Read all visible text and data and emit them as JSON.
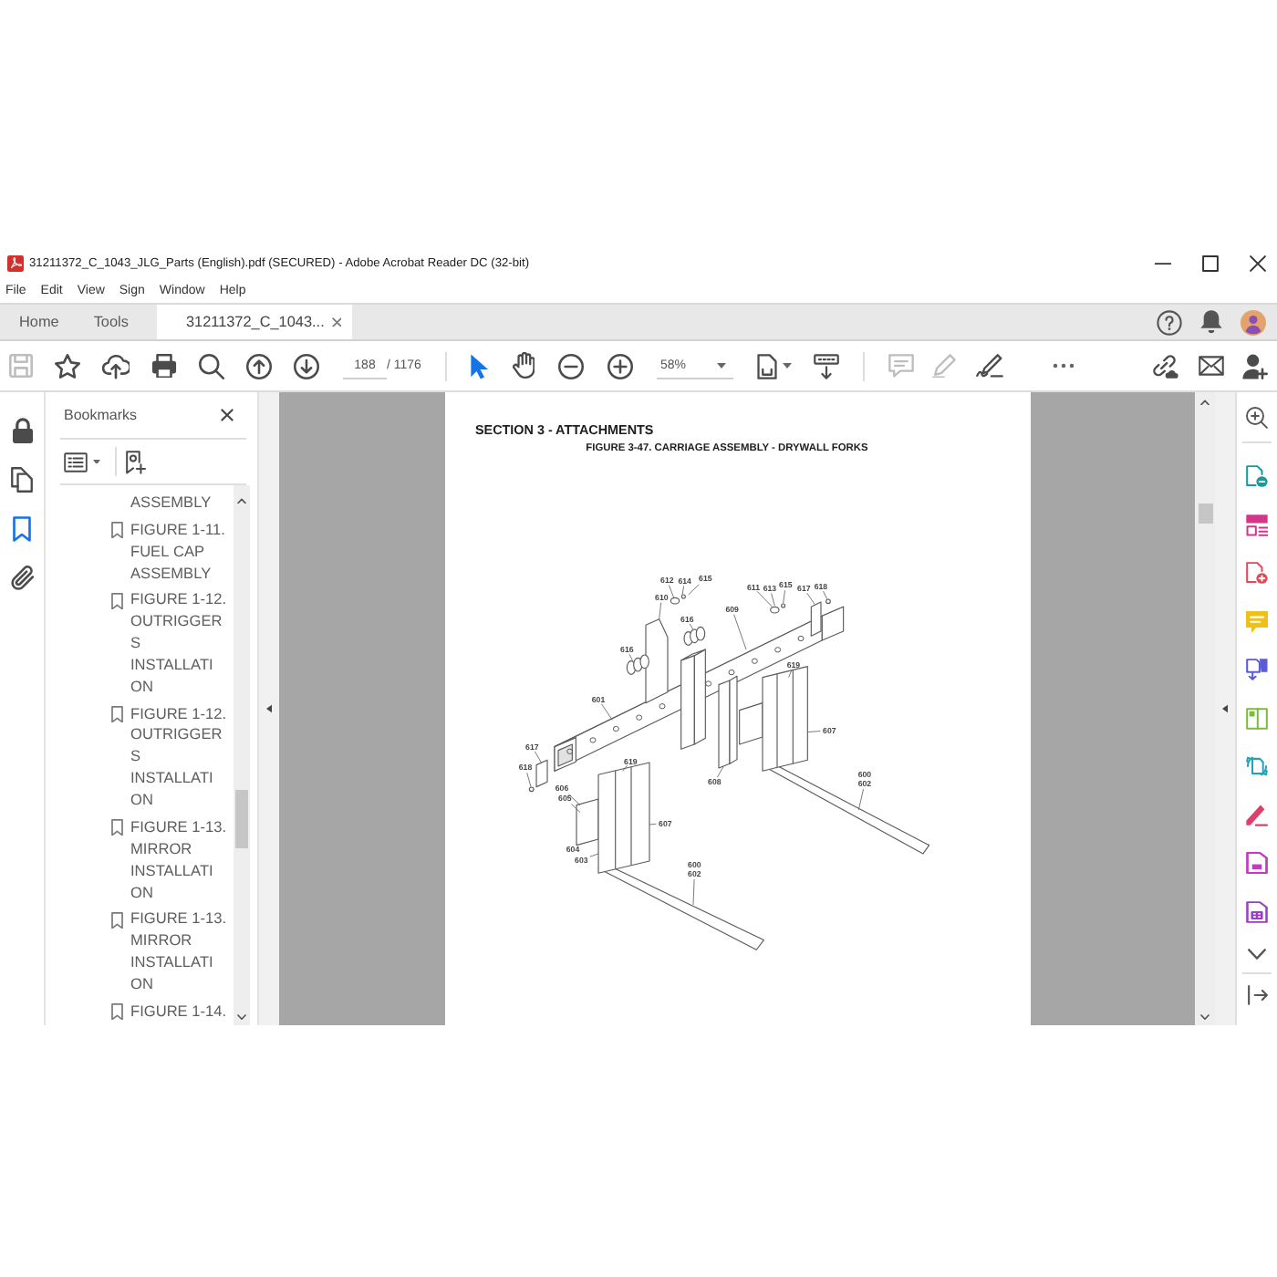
{
  "window": {
    "title": "31211372_C_1043_JLG_Parts (English).pdf (SECURED) - Adobe Acrobat Reader DC (32-bit)"
  },
  "menu": [
    "File",
    "Edit",
    "View",
    "Sign",
    "Window",
    "Help"
  ],
  "tabs": [
    {
      "label": "Home",
      "kind": "tool",
      "selected": false
    },
    {
      "label": "Tools",
      "kind": "tool",
      "selected": false
    },
    {
      "label": "31211372_C_1043...",
      "kind": "document",
      "selected": true
    }
  ],
  "toolbar": {
    "file_tools": [
      {
        "kind": "save",
        "disabled": true
      },
      {
        "kind": "star",
        "disabled": false
      },
      {
        "kind": "upload",
        "disabled": false
      },
      {
        "kind": "print",
        "disabled": false
      },
      {
        "kind": "search",
        "disabled": false
      },
      {
        "kind": "previous",
        "disabled": false
      },
      {
        "kind": "next",
        "disabled": false
      }
    ],
    "page_number": {
      "value": "188"
    },
    "page_count": "/ 1176",
    "view_tools": [
      {
        "kind": "select",
        "selected": true
      },
      {
        "kind": "hand",
        "selected": false
      },
      {
        "kind": "zoom-out",
        "selected": false
      },
      {
        "kind": "zoom-in",
        "selected": false
      }
    ],
    "zoom": {
      "value": "58%"
    },
    "markup_tools": [
      {
        "kind": "comment",
        "disabled": true
      },
      {
        "kind": "highlight",
        "disabled": true
      },
      {
        "kind": "sign",
        "disabled": false
      }
    ]
  },
  "left_rail": [
    {
      "kind": "lock",
      "selected": false
    },
    {
      "kind": "pages",
      "selected": false
    },
    {
      "kind": "bookmarks",
      "selected": true
    },
    {
      "kind": "attachments",
      "selected": false
    }
  ],
  "bookmarks": {
    "title": "Bookmarks",
    "items": [
      {
        "kind": "continued",
        "label": "ASSEMBLY"
      },
      {
        "kind": "bookmark",
        "label": "FIGURE 1-11. FUEL CAP ASSEMBLY"
      },
      {
        "kind": "bookmark",
        "label": "FIGURE 1-12. OUTRIGGERS INSTALLATION"
      },
      {
        "kind": "bookmark",
        "label": "FIGURE 1-12. OUTRIGGERS INSTALLATION"
      },
      {
        "kind": "bookmark",
        "label": "FIGURE 1-13. MIRROR INSTALLATION"
      },
      {
        "kind": "bookmark",
        "label": "FIGURE 1-13. MIRROR INSTALLATION"
      },
      {
        "kind": "bookmark",
        "label": "FIGURE 1-14."
      }
    ]
  },
  "document": {
    "section": "SECTION 3 - ATTACHMENTS",
    "figure_title": "FIGURE 3-47. CARRIAGE ASSEMBLY - DRYWALL FORKS",
    "callouts": [
      "612",
      "614",
      "615",
      "610",
      "616",
      "609",
      "611",
      "613",
      "615",
      "617",
      "618",
      "616",
      "619",
      "601",
      "607",
      "617",
      "618",
      "619",
      "606",
      "605",
      "608",
      "600",
      "602",
      "607",
      "604",
      "603",
      "600",
      "602"
    ]
  }
}
